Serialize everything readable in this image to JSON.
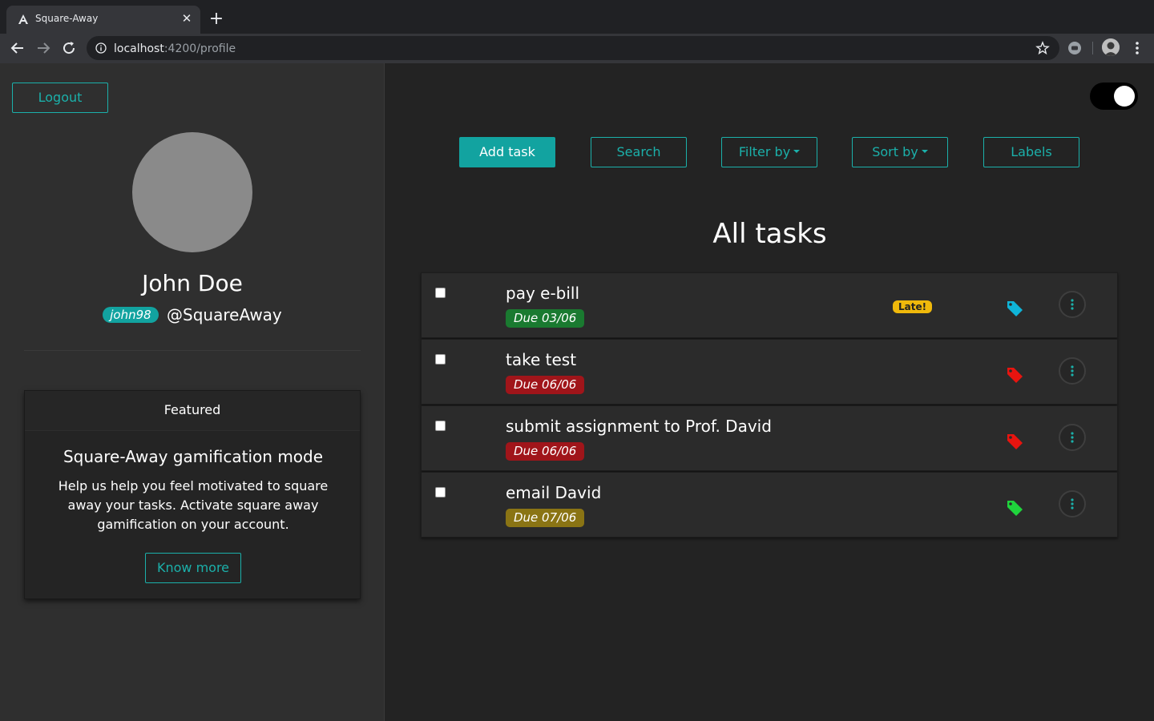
{
  "browser": {
    "tab_title": "Square-Away",
    "url_host": "localhost",
    "url_path": ":4200/profile"
  },
  "sidebar": {
    "logout_label": "Logout",
    "name": "John Doe",
    "username_pill": "john98",
    "handle": "@SquareAway",
    "featured": {
      "header": "Featured",
      "title": "Square-Away gamification mode",
      "text": "Help us help you feel motivated to square away your tasks. Activate square away gamification on your account.",
      "button_label": "Know more"
    }
  },
  "main": {
    "dark_mode_on": true,
    "actions": {
      "add_task": "Add task",
      "search": "Search",
      "filter_by": "Filter by",
      "sort_by": "Sort by",
      "labels": "Labels"
    },
    "list_title": "All tasks",
    "tasks": [
      {
        "name": "pay e-bill",
        "due": "Due 03/06",
        "due_color": "#1a7a30",
        "late": "Late!",
        "tag_color": "#0fb4d8",
        "checked": false
      },
      {
        "name": "take test",
        "due": "Due 06/06",
        "due_color": "#a0151a",
        "late": "",
        "tag_color": "#e8140f",
        "checked": false
      },
      {
        "name": "submit assignment to Prof. David",
        "due": "Due 06/06",
        "due_color": "#a0151a",
        "late": "",
        "tag_color": "#e8140f",
        "checked": false
      },
      {
        "name": "email David",
        "due": "Due 07/06",
        "due_color": "#8a7414",
        "late": "",
        "tag_color": "#1fd43c",
        "checked": false
      }
    ]
  },
  "colors": {
    "accent": "#1bb0aa",
    "late_badge": "#f0b90b"
  }
}
